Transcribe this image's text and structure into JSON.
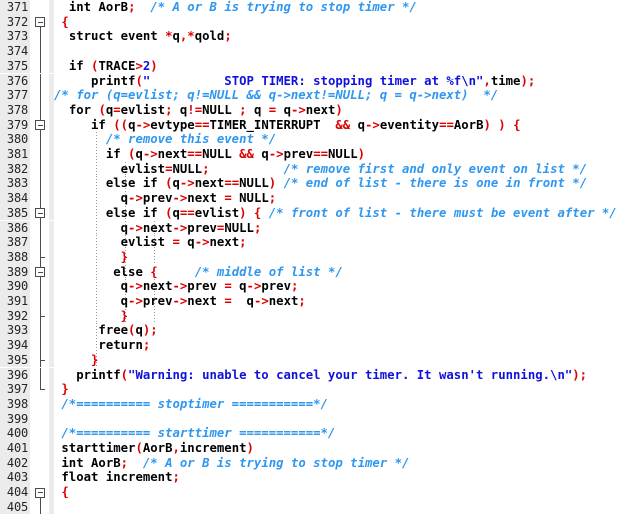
{
  "editor": {
    "name": "source-code-editor",
    "language": "C",
    "first_line": 371,
    "last_line": 405,
    "colors": {
      "background": "#ffffff",
      "gutter_background": "#ebebeb",
      "line_number": "#252525",
      "keyword": "#000000",
      "operator": "#dd0000",
      "string": "#1111dd",
      "number": "#1111dd",
      "comment": "#2e97f0",
      "fold_marker": "#4c4c4c",
      "indent_guide": "#9a9a9a"
    }
  },
  "lines": [
    {
      "num": "371",
      "fold": "none",
      "guides": 0,
      "tokens": [
        {
          "t": "pl",
          "v": "  "
        },
        {
          "t": "kw",
          "v": "int"
        },
        {
          "t": "pl",
          "v": " "
        },
        {
          "t": "id",
          "v": "AorB"
        },
        {
          "t": "op",
          "v": ";"
        },
        {
          "t": "pl",
          "v": "  "
        },
        {
          "t": "cm",
          "v": "/* A or B is trying to stop timer */"
        }
      ]
    },
    {
      "num": "372",
      "fold": "boxtop",
      "guides": 0,
      "tokens": [
        {
          "t": "pl",
          "v": " "
        },
        {
          "t": "op",
          "v": "{"
        }
      ]
    },
    {
      "num": "373",
      "fold": "line",
      "guides": 0,
      "tokens": [
        {
          "t": "pl",
          "v": "  "
        },
        {
          "t": "kw",
          "v": "struct"
        },
        {
          "t": "pl",
          "v": " "
        },
        {
          "t": "id",
          "v": "event"
        },
        {
          "t": "pl",
          "v": " "
        },
        {
          "t": "op",
          "v": "*"
        },
        {
          "t": "id",
          "v": "q"
        },
        {
          "t": "op",
          "v": ",*"
        },
        {
          "t": "id",
          "v": "qold"
        },
        {
          "t": "op",
          "v": ";"
        }
      ]
    },
    {
      "num": "374",
      "fold": "line",
      "guides": 0,
      "tokens": []
    },
    {
      "num": "375",
      "fold": "line",
      "guides": 0,
      "tokens": [
        {
          "t": "pl",
          "v": "  "
        },
        {
          "t": "kw",
          "v": "if"
        },
        {
          "t": "pl",
          "v": " "
        },
        {
          "t": "op",
          "v": "("
        },
        {
          "t": "id",
          "v": "TRACE"
        },
        {
          "t": "op",
          "v": ">"
        },
        {
          "t": "num",
          "v": "2"
        },
        {
          "t": "op",
          "v": ")"
        }
      ]
    },
    {
      "num": "376",
      "fold": "line",
      "guides": 0,
      "tokens": [
        {
          "t": "pl",
          "v": "     "
        },
        {
          "t": "id",
          "v": "printf"
        },
        {
          "t": "op",
          "v": "("
        },
        {
          "t": "str",
          "v": "\"          STOP TIMER: stopping timer at %f\\n\""
        },
        {
          "t": "op",
          "v": ","
        },
        {
          "t": "id",
          "v": "time"
        },
        {
          "t": "op",
          "v": ");"
        }
      ]
    },
    {
      "num": "377",
      "fold": "line",
      "guides": 0,
      "tokens": [
        {
          "t": "cm",
          "v": "/* for (q=evlist; q!=NULL && q->next!=NULL; q = q->next)  */"
        }
      ]
    },
    {
      "num": "378",
      "fold": "line",
      "guides": 0,
      "tokens": [
        {
          "t": "pl",
          "v": "  "
        },
        {
          "t": "kw",
          "v": "for"
        },
        {
          "t": "pl",
          "v": " "
        },
        {
          "t": "op",
          "v": "("
        },
        {
          "t": "id",
          "v": "q"
        },
        {
          "t": "op",
          "v": "="
        },
        {
          "t": "id",
          "v": "evlist"
        },
        {
          "t": "op",
          "v": ";"
        },
        {
          "t": "pl",
          "v": " "
        },
        {
          "t": "id",
          "v": "q"
        },
        {
          "t": "op",
          "v": "!="
        },
        {
          "t": "id",
          "v": "NULL"
        },
        {
          "t": "pl",
          "v": " "
        },
        {
          "t": "op",
          "v": ";"
        },
        {
          "t": "pl",
          "v": " "
        },
        {
          "t": "id",
          "v": "q"
        },
        {
          "t": "pl",
          "v": " "
        },
        {
          "t": "op",
          "v": "="
        },
        {
          "t": "pl",
          "v": " "
        },
        {
          "t": "id",
          "v": "q"
        },
        {
          "t": "op",
          "v": "->"
        },
        {
          "t": "id",
          "v": "next"
        },
        {
          "t": "op",
          "v": ")"
        }
      ]
    },
    {
      "num": "379",
      "fold": "boxmid",
      "guides": 0,
      "tokens": [
        {
          "t": "pl",
          "v": "     "
        },
        {
          "t": "kw",
          "v": "if"
        },
        {
          "t": "pl",
          "v": " "
        },
        {
          "t": "op",
          "v": "(("
        },
        {
          "t": "id",
          "v": "q"
        },
        {
          "t": "op",
          "v": "->"
        },
        {
          "t": "id",
          "v": "evtype"
        },
        {
          "t": "op",
          "v": "=="
        },
        {
          "t": "id",
          "v": "TIMER_INTERRUPT"
        },
        {
          "t": "pl",
          "v": "  "
        },
        {
          "t": "op",
          "v": "&&"
        },
        {
          "t": "pl",
          "v": " "
        },
        {
          "t": "id",
          "v": "q"
        },
        {
          "t": "op",
          "v": "->"
        },
        {
          "t": "id",
          "v": "eventity"
        },
        {
          "t": "op",
          "v": "=="
        },
        {
          "t": "id",
          "v": "AorB"
        },
        {
          "t": "op",
          "v": ") ) {"
        }
      ]
    },
    {
      "num": "380",
      "fold": "line",
      "guides": 1,
      "tokens": [
        {
          "t": "pl",
          "v": "       "
        },
        {
          "t": "cm",
          "v": "/* remove this event */"
        }
      ]
    },
    {
      "num": "381",
      "fold": "line",
      "guides": 1,
      "tokens": [
        {
          "t": "pl",
          "v": "       "
        },
        {
          "t": "kw",
          "v": "if"
        },
        {
          "t": "pl",
          "v": " "
        },
        {
          "t": "op",
          "v": "("
        },
        {
          "t": "id",
          "v": "q"
        },
        {
          "t": "op",
          "v": "->"
        },
        {
          "t": "id",
          "v": "next"
        },
        {
          "t": "op",
          "v": "=="
        },
        {
          "t": "id",
          "v": "NULL"
        },
        {
          "t": "pl",
          "v": " "
        },
        {
          "t": "op",
          "v": "&&"
        },
        {
          "t": "pl",
          "v": " "
        },
        {
          "t": "id",
          "v": "q"
        },
        {
          "t": "op",
          "v": "->"
        },
        {
          "t": "id",
          "v": "prev"
        },
        {
          "t": "op",
          "v": "=="
        },
        {
          "t": "id",
          "v": "NULL"
        },
        {
          "t": "op",
          "v": ")"
        }
      ]
    },
    {
      "num": "382",
      "fold": "line",
      "guides": 2,
      "tokens": [
        {
          "t": "pl",
          "v": "         "
        },
        {
          "t": "id",
          "v": "evlist"
        },
        {
          "t": "op",
          "v": "="
        },
        {
          "t": "id",
          "v": "NULL"
        },
        {
          "t": "op",
          "v": ";"
        },
        {
          "t": "pl",
          "v": "          "
        },
        {
          "t": "cm",
          "v": "/* remove first and only event on list */"
        }
      ]
    },
    {
      "num": "383",
      "fold": "line",
      "guides": 2,
      "tokens": [
        {
          "t": "pl",
          "v": "       "
        },
        {
          "t": "kw",
          "v": "else"
        },
        {
          "t": "pl",
          "v": " "
        },
        {
          "t": "kw",
          "v": "if"
        },
        {
          "t": "pl",
          "v": " "
        },
        {
          "t": "op",
          "v": "("
        },
        {
          "t": "id",
          "v": "q"
        },
        {
          "t": "op",
          "v": "->"
        },
        {
          "t": "id",
          "v": "next"
        },
        {
          "t": "op",
          "v": "=="
        },
        {
          "t": "id",
          "v": "NULL"
        },
        {
          "t": "op",
          "v": ")"
        },
        {
          "t": "pl",
          "v": " "
        },
        {
          "t": "cm",
          "v": "/* end of list - there is one in front */"
        }
      ]
    },
    {
      "num": "384",
      "fold": "line",
      "guides": 2,
      "tokens": [
        {
          "t": "pl",
          "v": "         "
        },
        {
          "t": "id",
          "v": "q"
        },
        {
          "t": "op",
          "v": "->"
        },
        {
          "t": "id",
          "v": "prev"
        },
        {
          "t": "op",
          "v": "->"
        },
        {
          "t": "id",
          "v": "next"
        },
        {
          "t": "pl",
          "v": " "
        },
        {
          "t": "op",
          "v": "="
        },
        {
          "t": "pl",
          "v": " "
        },
        {
          "t": "id",
          "v": "NULL"
        },
        {
          "t": "op",
          "v": ";"
        }
      ]
    },
    {
      "num": "385",
      "fold": "boxmid",
      "guides": 2,
      "tokens": [
        {
          "t": "pl",
          "v": "       "
        },
        {
          "t": "kw",
          "v": "else"
        },
        {
          "t": "pl",
          "v": " "
        },
        {
          "t": "kw",
          "v": "if"
        },
        {
          "t": "pl",
          "v": " "
        },
        {
          "t": "op",
          "v": "("
        },
        {
          "t": "id",
          "v": "q"
        },
        {
          "t": "op",
          "v": "=="
        },
        {
          "t": "id",
          "v": "evlist"
        },
        {
          "t": "op",
          "v": ") {"
        },
        {
          "t": "pl",
          "v": " "
        },
        {
          "t": "cm",
          "v": "/* front of list - there must be event after */"
        }
      ]
    },
    {
      "num": "386",
      "fold": "line",
      "guides": 3,
      "tokens": [
        {
          "t": "pl",
          "v": "         "
        },
        {
          "t": "id",
          "v": "q"
        },
        {
          "t": "op",
          "v": "->"
        },
        {
          "t": "id",
          "v": "next"
        },
        {
          "t": "op",
          "v": "->"
        },
        {
          "t": "id",
          "v": "prev"
        },
        {
          "t": "op",
          "v": "="
        },
        {
          "t": "id",
          "v": "NULL"
        },
        {
          "t": "op",
          "v": ";"
        }
      ]
    },
    {
      "num": "387",
      "fold": "line",
      "guides": 3,
      "tokens": [
        {
          "t": "pl",
          "v": "         "
        },
        {
          "t": "id",
          "v": "evlist"
        },
        {
          "t": "pl",
          "v": " "
        },
        {
          "t": "op",
          "v": "="
        },
        {
          "t": "pl",
          "v": " "
        },
        {
          "t": "id",
          "v": "q"
        },
        {
          "t": "op",
          "v": "->"
        },
        {
          "t": "id",
          "v": "next"
        },
        {
          "t": "op",
          "v": ";"
        }
      ]
    },
    {
      "num": "388",
      "fold": "tee",
      "guides": 3,
      "tokens": [
        {
          "t": "pl",
          "v": "         "
        },
        {
          "t": "op",
          "v": "}"
        }
      ]
    },
    {
      "num": "389",
      "fold": "boxmid",
      "guides": 2,
      "tokens": [
        {
          "t": "pl",
          "v": "        "
        },
        {
          "t": "kw",
          "v": "else"
        },
        {
          "t": "pl",
          "v": " "
        },
        {
          "t": "op",
          "v": "{"
        },
        {
          "t": "pl",
          "v": "     "
        },
        {
          "t": "cm",
          "v": "/* middle of list */"
        }
      ]
    },
    {
      "num": "390",
      "fold": "line",
      "guides": 3,
      "tokens": [
        {
          "t": "pl",
          "v": "         "
        },
        {
          "t": "id",
          "v": "q"
        },
        {
          "t": "op",
          "v": "->"
        },
        {
          "t": "id",
          "v": "next"
        },
        {
          "t": "op",
          "v": "->"
        },
        {
          "t": "id",
          "v": "prev"
        },
        {
          "t": "pl",
          "v": " "
        },
        {
          "t": "op",
          "v": "="
        },
        {
          "t": "pl",
          "v": " "
        },
        {
          "t": "id",
          "v": "q"
        },
        {
          "t": "op",
          "v": "->"
        },
        {
          "t": "id",
          "v": "prev"
        },
        {
          "t": "op",
          "v": ";"
        }
      ]
    },
    {
      "num": "391",
      "fold": "line",
      "guides": 3,
      "tokens": [
        {
          "t": "pl",
          "v": "         "
        },
        {
          "t": "id",
          "v": "q"
        },
        {
          "t": "op",
          "v": "->"
        },
        {
          "t": "id",
          "v": "prev"
        },
        {
          "t": "op",
          "v": "->"
        },
        {
          "t": "id",
          "v": "next"
        },
        {
          "t": "pl",
          "v": " "
        },
        {
          "t": "op",
          "v": "="
        },
        {
          "t": "pl",
          "v": "  "
        },
        {
          "t": "id",
          "v": "q"
        },
        {
          "t": "op",
          "v": "->"
        },
        {
          "t": "id",
          "v": "next"
        },
        {
          "t": "op",
          "v": ";"
        }
      ]
    },
    {
      "num": "392",
      "fold": "tee",
      "guides": 3,
      "tokens": [
        {
          "t": "pl",
          "v": "         "
        },
        {
          "t": "op",
          "v": "}"
        }
      ]
    },
    {
      "num": "393",
      "fold": "line",
      "guides": 1,
      "tokens": [
        {
          "t": "pl",
          "v": "      "
        },
        {
          "t": "id",
          "v": "free"
        },
        {
          "t": "op",
          "v": "("
        },
        {
          "t": "id",
          "v": "q"
        },
        {
          "t": "op",
          "v": ");"
        }
      ]
    },
    {
      "num": "394",
      "fold": "line",
      "guides": 1,
      "tokens": [
        {
          "t": "pl",
          "v": "      "
        },
        {
          "t": "kw",
          "v": "return"
        },
        {
          "t": "op",
          "v": ";"
        }
      ]
    },
    {
      "num": "395",
      "fold": "tee",
      "guides": 1,
      "tokens": [
        {
          "t": "pl",
          "v": "     "
        },
        {
          "t": "op",
          "v": "}"
        }
      ]
    },
    {
      "num": "396",
      "fold": "line",
      "guides": 0,
      "tokens": [
        {
          "t": "pl",
          "v": "   "
        },
        {
          "t": "id",
          "v": "printf"
        },
        {
          "t": "op",
          "v": "("
        },
        {
          "t": "str",
          "v": "\"Warning: unable to cancel your timer. It wasn't running.\\n\""
        },
        {
          "t": "op",
          "v": ");"
        }
      ]
    },
    {
      "num": "397",
      "fold": "end",
      "guides": 0,
      "tokens": [
        {
          "t": "pl",
          "v": " "
        },
        {
          "t": "op",
          "v": "}"
        }
      ]
    },
    {
      "num": "398",
      "fold": "none",
      "guides": 0,
      "tokens": [
        {
          "t": "pl",
          "v": " "
        },
        {
          "t": "cm",
          "v": "/*========== stoptimer ===========*/"
        }
      ]
    },
    {
      "num": "399",
      "fold": "none",
      "guides": 0,
      "tokens": []
    },
    {
      "num": "400",
      "fold": "none",
      "guides": 0,
      "tokens": [
        {
          "t": "pl",
          "v": " "
        },
        {
          "t": "cm",
          "v": "/*========== starttimer ===========*/"
        }
      ]
    },
    {
      "num": "401",
      "fold": "none",
      "guides": 0,
      "tokens": [
        {
          "t": "pl",
          "v": " "
        },
        {
          "t": "id",
          "v": "starttimer"
        },
        {
          "t": "op",
          "v": "("
        },
        {
          "t": "id",
          "v": "AorB"
        },
        {
          "t": "op",
          "v": ","
        },
        {
          "t": "id",
          "v": "increment"
        },
        {
          "t": "op",
          "v": ")"
        }
      ]
    },
    {
      "num": "402",
      "fold": "none",
      "guides": 0,
      "tokens": [
        {
          "t": "pl",
          "v": " "
        },
        {
          "t": "kw",
          "v": "int"
        },
        {
          "t": "pl",
          "v": " "
        },
        {
          "t": "id",
          "v": "AorB"
        },
        {
          "t": "op",
          "v": ";"
        },
        {
          "t": "pl",
          "v": "  "
        },
        {
          "t": "cm",
          "v": "/* A or B is trying to stop timer */"
        }
      ]
    },
    {
      "num": "403",
      "fold": "none",
      "guides": 0,
      "tokens": [
        {
          "t": "pl",
          "v": " "
        },
        {
          "t": "kw",
          "v": "float"
        },
        {
          "t": "pl",
          "v": " "
        },
        {
          "t": "id",
          "v": "increment"
        },
        {
          "t": "op",
          "v": ";"
        }
      ]
    },
    {
      "num": "404",
      "fold": "boxtop",
      "guides": 0,
      "tokens": [
        {
          "t": "pl",
          "v": " "
        },
        {
          "t": "op",
          "v": "{"
        }
      ]
    },
    {
      "num": "405",
      "fold": "line",
      "guides": 0,
      "tokens": []
    }
  ]
}
